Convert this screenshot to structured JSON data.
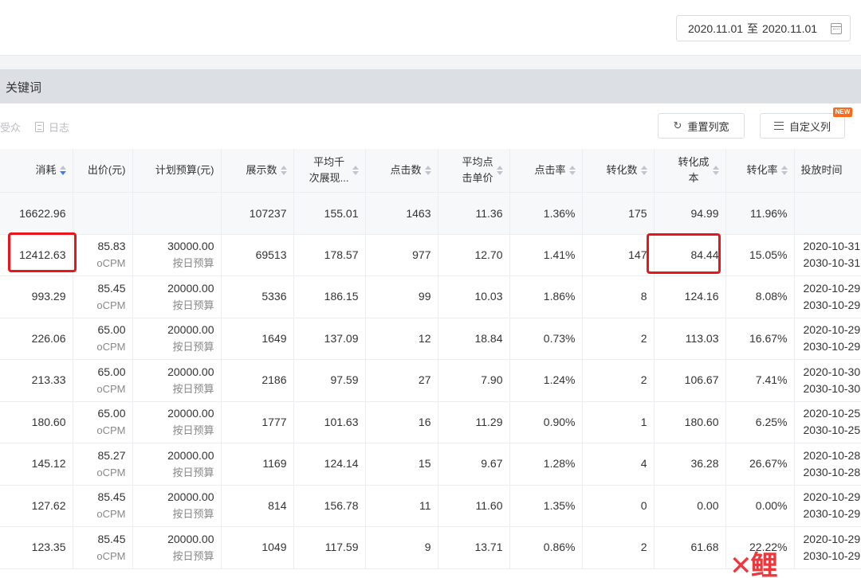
{
  "date_range": {
    "start": "2020.11.01",
    "separator": "至",
    "end": "2020.11.01"
  },
  "section_title": "关键词",
  "tabs": [
    {
      "label": "受众"
    },
    {
      "label": "日志"
    }
  ],
  "toolbar": {
    "reset_label": "重置列宽",
    "custom_label": "自定义列",
    "new_badge": "NEW"
  },
  "columns": [
    {
      "label": "消耗",
      "sortable": true,
      "active": true
    },
    {
      "label": "出价(元)",
      "sortable": false
    },
    {
      "label": "计划预算(元)",
      "sortable": false
    },
    {
      "label": "展示数",
      "sortable": true
    },
    {
      "label": "平均千次展现...",
      "line1": "平均千",
      "line2": "次展现...",
      "sortable": true
    },
    {
      "label": "点击数",
      "sortable": true
    },
    {
      "label": "平均点击单价",
      "line1": "平均点",
      "line2": "击单价",
      "sortable": true
    },
    {
      "label": "点击率",
      "sortable": true
    },
    {
      "label": "转化数",
      "sortable": true
    },
    {
      "label": "转化成本",
      "line1": "转化成",
      "line2": "本",
      "sortable": true
    },
    {
      "label": "转化率",
      "sortable": true
    },
    {
      "label": "投放时间",
      "sortable": false
    }
  ],
  "totals": {
    "cost": "16622.96",
    "impressions": "107237",
    "cpm": "155.01",
    "clicks": "1463",
    "cpc": "11.36",
    "ctr": "1.36%",
    "conversions": "175",
    "cpa": "94.99",
    "cvr": "11.96%"
  },
  "rows": [
    {
      "cost": "12412.63",
      "bid": "85.83",
      "bid_type": "oCPM",
      "budget": "30000.00",
      "budget_type": "按日预算",
      "impressions": "69513",
      "cpm": "178.57",
      "clicks": "977",
      "cpc": "12.70",
      "ctr": "1.41%",
      "conversions": "147",
      "cpa": "84.44",
      "cvr": "15.05%",
      "start": "2020-10-31",
      "end": "2030-10-31"
    },
    {
      "cost": "993.29",
      "bid": "85.45",
      "bid_type": "oCPM",
      "budget": "20000.00",
      "budget_type": "按日预算",
      "impressions": "5336",
      "cpm": "186.15",
      "clicks": "99",
      "cpc": "10.03",
      "ctr": "1.86%",
      "conversions": "8",
      "cpa": "124.16",
      "cvr": "8.08%",
      "start": "2020-10-29",
      "end": "2030-10-29"
    },
    {
      "cost": "226.06",
      "bid": "65.00",
      "bid_type": "oCPM",
      "budget": "20000.00",
      "budget_type": "按日预算",
      "impressions": "1649",
      "cpm": "137.09",
      "clicks": "12",
      "cpc": "18.84",
      "ctr": "0.73%",
      "conversions": "2",
      "cpa": "113.03",
      "cvr": "16.67%",
      "start": "2020-10-29",
      "end": "2030-10-29"
    },
    {
      "cost": "213.33",
      "bid": "65.00",
      "bid_type": "oCPM",
      "budget": "20000.00",
      "budget_type": "按日预算",
      "impressions": "2186",
      "cpm": "97.59",
      "clicks": "27",
      "cpc": "7.90",
      "ctr": "1.24%",
      "conversions": "2",
      "cpa": "106.67",
      "cvr": "7.41%",
      "start": "2020-10-30",
      "end": "2030-10-30"
    },
    {
      "cost": "180.60",
      "bid": "65.00",
      "bid_type": "oCPM",
      "budget": "20000.00",
      "budget_type": "按日预算",
      "impressions": "1777",
      "cpm": "101.63",
      "clicks": "16",
      "cpc": "11.29",
      "ctr": "0.90%",
      "conversions": "1",
      "cpa": "180.60",
      "cvr": "6.25%",
      "start": "2020-10-25",
      "end": "2030-10-25"
    },
    {
      "cost": "145.12",
      "bid": "85.27",
      "bid_type": "oCPM",
      "budget": "20000.00",
      "budget_type": "按日预算",
      "impressions": "1169",
      "cpm": "124.14",
      "clicks": "15",
      "cpc": "9.67",
      "ctr": "1.28%",
      "conversions": "4",
      "cpa": "36.28",
      "cvr": "26.67%",
      "start": "2020-10-28",
      "end": "2030-10-28"
    },
    {
      "cost": "127.62",
      "bid": "85.45",
      "bid_type": "oCPM",
      "budget": "20000.00",
      "budget_type": "按日预算",
      "impressions": "814",
      "cpm": "156.78",
      "clicks": "11",
      "cpc": "11.60",
      "ctr": "1.35%",
      "conversions": "0",
      "cpa": "0.00",
      "cvr": "0.00%",
      "start": "2020-10-29",
      "end": "2030-10-29"
    },
    {
      "cost": "123.35",
      "bid": "85.45",
      "bid_type": "oCPM",
      "budget": "20000.00",
      "budget_type": "按日预算",
      "impressions": "1049",
      "cpm": "117.59",
      "clicks": "9",
      "cpc": "13.71",
      "ctr": "0.86%",
      "conversions": "2",
      "cpa": "61.68",
      "cvr": "22.22%",
      "start": "2020-10-29",
      "end": "2030-10-29"
    }
  ],
  "watermark": "鲤",
  "colors": {
    "highlight": "#e8161b",
    "sort_active": "#3a7bfa",
    "new_badge": "#ff6a1a"
  }
}
